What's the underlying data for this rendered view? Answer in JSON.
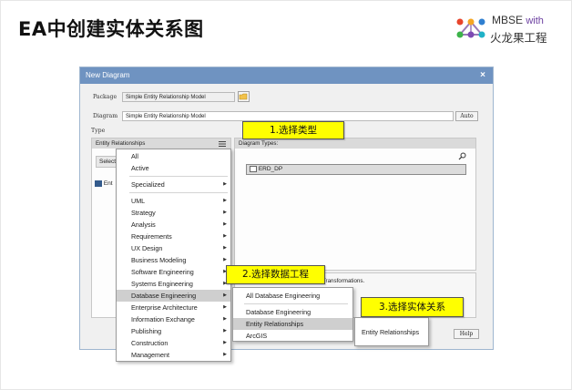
{
  "slide": {
    "title": "EA中创建实体关系图",
    "logo": {
      "line1": "MBSE",
      "line1_with": "with",
      "line2": "火龙果工程"
    }
  },
  "dialog": {
    "title": "New Diagram",
    "close": "×",
    "package_label": "Package",
    "package_value": "Simple Entity Relationship Model",
    "diagram_label": "Diagram",
    "diagram_value": "Simple Entity Relationship Model",
    "auto_button": "Auto",
    "type_label": "Type",
    "type_dropdown": "Entity Relationships",
    "select_partial": "Select",
    "left_item_partial": "Ent",
    "diagram_types_header": "Diagram Types:",
    "diagram_types": [
      "ERD_DP"
    ],
    "description_partial": "Transformations.",
    "help_button": "Help"
  },
  "menu_main": {
    "items": [
      {
        "label": "All",
        "has_sub": false
      },
      {
        "label": "Active",
        "has_sub": false
      },
      {
        "label": "Specialized",
        "has_sub": true
      },
      {
        "label": "UML",
        "has_sub": true
      },
      {
        "label": "Strategy",
        "has_sub": true
      },
      {
        "label": "Analysis",
        "has_sub": true
      },
      {
        "label": "Requirements",
        "has_sub": true
      },
      {
        "label": "UX Design",
        "has_sub": true
      },
      {
        "label": "Business Modeling",
        "has_sub": true
      },
      {
        "label": "Software Engineering",
        "has_sub": true
      },
      {
        "label": "Systems Engineering",
        "has_sub": true
      },
      {
        "label": "Database Engineering",
        "has_sub": true
      },
      {
        "label": "Enterprise Architecture",
        "has_sub": true
      },
      {
        "label": "Information Exchange",
        "has_sub": true
      },
      {
        "label": "Publishing",
        "has_sub": true
      },
      {
        "label": "Construction",
        "has_sub": true
      },
      {
        "label": "Management",
        "has_sub": true
      }
    ],
    "highlighted": "Database Engineering"
  },
  "menu_sub": {
    "items": [
      "All Database Engineering",
      "Database Engineering",
      "Entity Relationships",
      "ArcGIS"
    ],
    "highlighted": "Entity Relationships"
  },
  "menu_sub2": {
    "items": [
      "Entity Relationships"
    ]
  },
  "callouts": {
    "step1": "1.选择类型",
    "step2": "2.选择数据工程",
    "step3": "3.选择实体关系"
  },
  "colors": {
    "titlebar": "#6f93c1",
    "callout": "#ffff00",
    "highlight": "#cfcfcf"
  }
}
